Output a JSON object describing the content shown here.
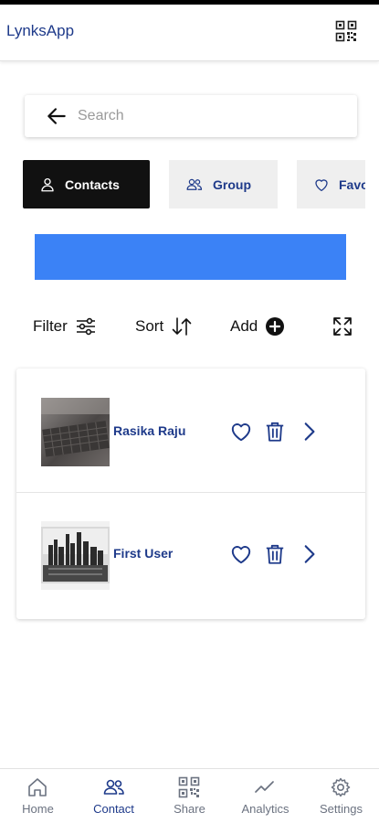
{
  "header": {
    "title": "LynksApp",
    "qr_icon": "qr-code-icon"
  },
  "search": {
    "placeholder": "Search",
    "value": "",
    "back_icon": "arrow-left-icon"
  },
  "tabs": [
    {
      "label": "Contacts",
      "icon": "person-icon",
      "active": true
    },
    {
      "label": "Group",
      "icon": "people-icon",
      "active": false
    },
    {
      "label": "Favorites",
      "icon": "heart-icon",
      "active": false
    }
  ],
  "banner": {
    "color": "#3b82f6"
  },
  "actions": {
    "filter_label": "Filter",
    "sort_label": "Sort",
    "add_label": "Add",
    "filter_icon": "sliders-icon",
    "sort_icon": "sort-arrows-icon",
    "add_icon": "plus-circle-icon",
    "expand_icon": "expand-icon"
  },
  "contacts": [
    {
      "name": "Rasika Raju",
      "avatar": "keyboard-photo"
    },
    {
      "name": "First User",
      "avatar": "city-skyline-photo"
    }
  ],
  "bottom_nav": [
    {
      "label": "Home",
      "icon": "home-icon",
      "active": false
    },
    {
      "label": "Contact",
      "icon": "people-icon",
      "active": true
    },
    {
      "label": "Share",
      "icon": "qr-code-icon",
      "active": false
    },
    {
      "label": "Analytics",
      "icon": "trend-icon",
      "active": false
    },
    {
      "label": "Settings",
      "icon": "gear-icon",
      "active": false
    }
  ],
  "colors": {
    "brand": "#1e3a8a",
    "active_tab": "#111111",
    "inactive_tab": "#efefef",
    "nav_inactive": "#6b7280"
  }
}
